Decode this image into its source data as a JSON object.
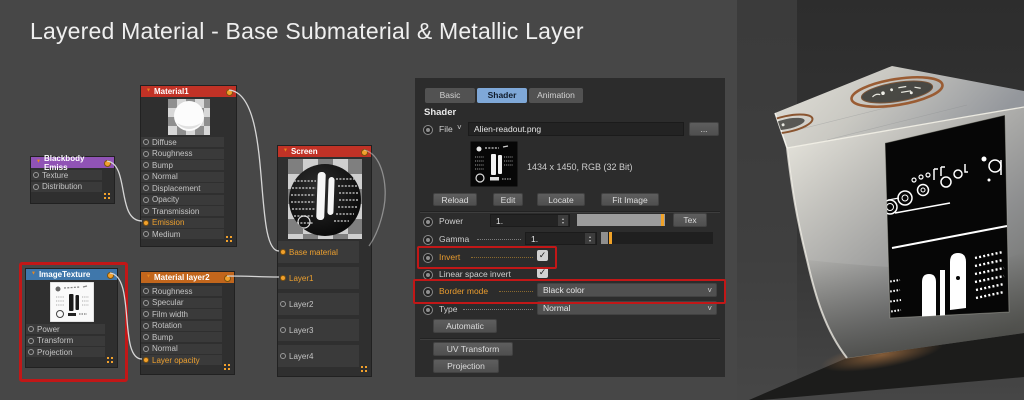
{
  "title": "Layered Material - Base Submaterial & Metallic Layer",
  "icons": {
    "triangle_down": "▼",
    "chevron_down": "˅",
    "check": "✓",
    "stepper_up": "▴",
    "stepper_down": "▾"
  },
  "colors": {
    "background": "#474747",
    "panel_background": "#2c2c2c",
    "accent_orange": "#E89B2E",
    "highlight_red": "#C21717",
    "tab_selected_blue": "#7FA8D8",
    "node_header_red": "#C13226",
    "node_header_purple": "#9053B5",
    "node_header_blue": "#3F77AB",
    "node_header_orange": "#C2661C",
    "wire": "#D6D6D6"
  },
  "nodes": {
    "blackbody_emission": {
      "title": "Blackbody Emiss",
      "ports": [
        {
          "label": "Texture"
        },
        {
          "label": "Distribution"
        }
      ]
    },
    "material1": {
      "title": "Material1",
      "ports": [
        {
          "label": "Diffuse"
        },
        {
          "label": "Roughness"
        },
        {
          "label": "Bump"
        },
        {
          "label": "Normal"
        },
        {
          "label": "Displacement"
        },
        {
          "label": "Opacity"
        },
        {
          "label": "Transmission"
        },
        {
          "label": "Emission",
          "connected": true
        },
        {
          "label": "Medium"
        }
      ]
    },
    "image_texture": {
      "title": "ImageTexture",
      "highlighted": true,
      "ports": [
        {
          "label": "Power"
        },
        {
          "label": "Transform"
        },
        {
          "label": "Projection"
        }
      ]
    },
    "material_layer2": {
      "title": "Material layer2",
      "ports": [
        {
          "label": "Roughness"
        },
        {
          "label": "Specular"
        },
        {
          "label": "Film width"
        },
        {
          "label": "Rotation"
        },
        {
          "label": "Bump"
        },
        {
          "label": "Normal"
        },
        {
          "label": "Layer opacity",
          "connected": true
        }
      ]
    },
    "screen": {
      "title": "Screen",
      "ports": [
        {
          "label": "Base material",
          "connected": true
        },
        {
          "label": "Layer1",
          "connected": true
        },
        {
          "label": "Layer2"
        },
        {
          "label": "Layer3"
        },
        {
          "label": "Layer4"
        }
      ]
    }
  },
  "panel": {
    "tabs": [
      {
        "label": "Basic"
      },
      {
        "label": "Shader",
        "selected": true
      },
      {
        "label": "Animation"
      }
    ],
    "section_heading": "Shader",
    "file_row": {
      "label": "File",
      "filename": "Alien-readout.png",
      "browse_label": "..."
    },
    "image_info": "1434 x 1450, RGB (32 Bit)",
    "file_buttons": [
      {
        "label": "Reload"
      },
      {
        "label": "Edit"
      },
      {
        "label": "Locate"
      },
      {
        "label": "Fit Image"
      }
    ],
    "power": {
      "label": "Power",
      "value": "1.",
      "tex_label": "Tex"
    },
    "gamma": {
      "label": "Gamma",
      "value": "1."
    },
    "invert": {
      "label": "Invert",
      "checked": true
    },
    "linear_space_invert": {
      "label": "Linear space invert",
      "checked": true
    },
    "border_mode": {
      "label": "Border mode",
      "value": "Black color"
    },
    "type": {
      "label": "Type",
      "value": "Normal"
    },
    "action_buttons": [
      {
        "label": "Automatic"
      },
      {
        "label": "UV Transform"
      },
      {
        "label": "Projection"
      }
    ]
  }
}
